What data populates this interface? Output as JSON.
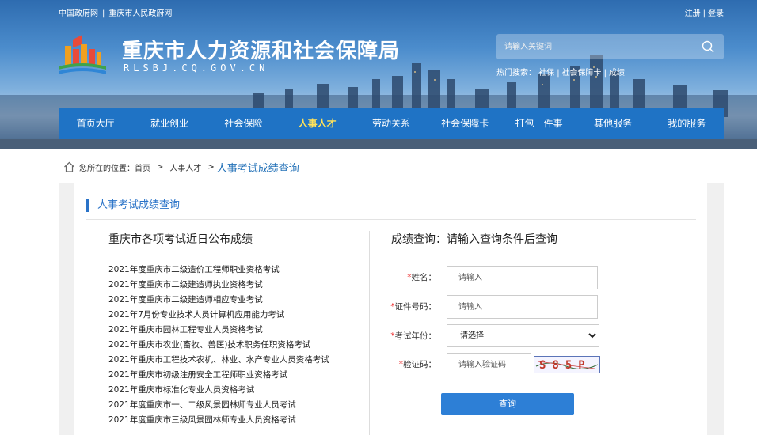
{
  "header": {
    "top_links": [
      "中国政府网",
      "重庆市人民政府网"
    ],
    "auth": {
      "register": "注册",
      "login": "登录"
    },
    "title": "重庆市人力资源和社会保障局",
    "domain": "RLSBJ.CQ.GOV.CN",
    "search_placeholder": "请输入关键词",
    "hot_label": "热门搜索：",
    "hot_items": [
      "社保",
      "社会保障卡",
      "成绩"
    ]
  },
  "nav": {
    "items": [
      "首页大厅",
      "就业创业",
      "社会保险",
      "人事人才",
      "劳动关系",
      "社会保障卡",
      "打包一件事",
      "其他服务",
      "我的服务"
    ],
    "active": "人事人才"
  },
  "breadcrumb": {
    "prefix": "您所在的位置：",
    "items": [
      "首页",
      "人事人才"
    ],
    "current": "人事考试成绩查询"
  },
  "section": {
    "title": "人事考试成绩查询"
  },
  "list": {
    "title": "重庆市各项考试近日公布成绩",
    "items": [
      "2021年度重庆市二级造价工程师职业资格考试",
      "2021年度重庆市二级建造师执业资格考试",
      "2021年度重庆市二级建造师相应专业考试",
      "2021年7月份专业技术人员计算机应用能力考试",
      "2021年重庆市园林工程专业人员资格考试",
      "2021年重庆市农业(畜牧、兽医)技术职务任职资格考试",
      "2021年重庆市工程技术农机、林业、水产专业人员资格考试",
      "2021年重庆市初级注册安全工程师职业资格考试",
      "2021年重庆市标准化专业人员资格考试",
      "2021年度重庆市一、二级风景园林师专业人员考试",
      "2021年度重庆市三级风景园林师专业人员资格考试"
    ]
  },
  "form": {
    "title": "成绩查询：请输入查询条件后查询",
    "name_label": "姓名：",
    "name_placeholder": "请输入",
    "id_label": "证件号码：",
    "id_placeholder": "请输入",
    "year_label": "考试年份：",
    "year_selected": "请选择",
    "code_label": "验证码：",
    "code_placeholder": "请输入验证码",
    "captcha_text": "S85P",
    "required_mark": "*",
    "submit": "查询"
  },
  "colors": {
    "nav_bg": "#1f73c5",
    "nav_active": "#ffe25a",
    "accent": "#2a73c8",
    "button": "#2d7fd6",
    "required": "#e33333"
  }
}
